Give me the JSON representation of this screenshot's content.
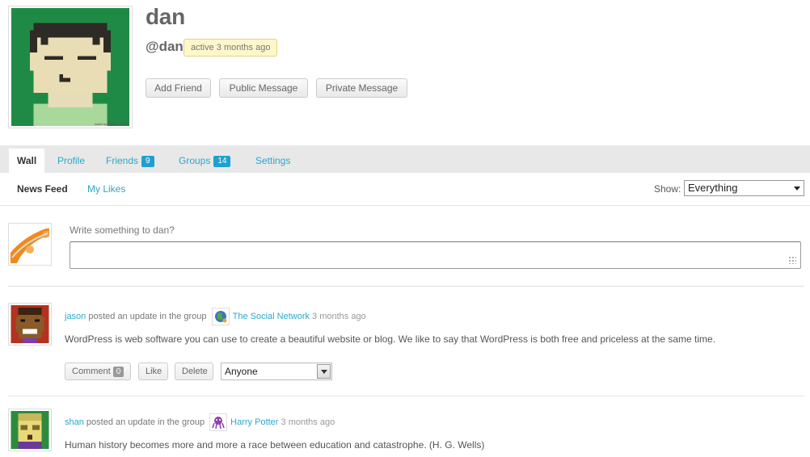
{
  "profile": {
    "name": "dan",
    "handle": "@dan",
    "activity": "active 3 months ago",
    "avatar_credit": "made by Mattias G.com",
    "buttons": {
      "add_friend": "Add Friend",
      "public_message": "Public Message",
      "private_message": "Private Message"
    }
  },
  "tabs": [
    {
      "label": "Wall",
      "current": true
    },
    {
      "label": "Profile"
    },
    {
      "label": "Friends",
      "count": "9"
    },
    {
      "label": "Groups",
      "count": "14"
    },
    {
      "label": "Settings"
    }
  ],
  "subnav": {
    "items": [
      "News Feed",
      "My Likes"
    ],
    "show_label": "Show:",
    "show_value": "Everything"
  },
  "post_form": {
    "prompt": "Write something to dan?"
  },
  "activities": [
    {
      "user": "jason",
      "action": "posted an update in the group",
      "group": "The Social Network",
      "time": "3 months ago",
      "content": "WordPress is web software you can use to create a beautiful website or blog. We like to say that WordPress is both free and priceless at the same time.",
      "comment_label": "Comment",
      "comment_count": "0",
      "like_label": "Like",
      "delete_label": "Delete",
      "privacy": "Anyone"
    },
    {
      "user": "shan",
      "action": "posted an update in the group",
      "group": "Harry Potter",
      "time": "3 months ago",
      "content": "Human history becomes more and more a race between education and catastrophe. (H. G. Wells)"
    }
  ]
}
